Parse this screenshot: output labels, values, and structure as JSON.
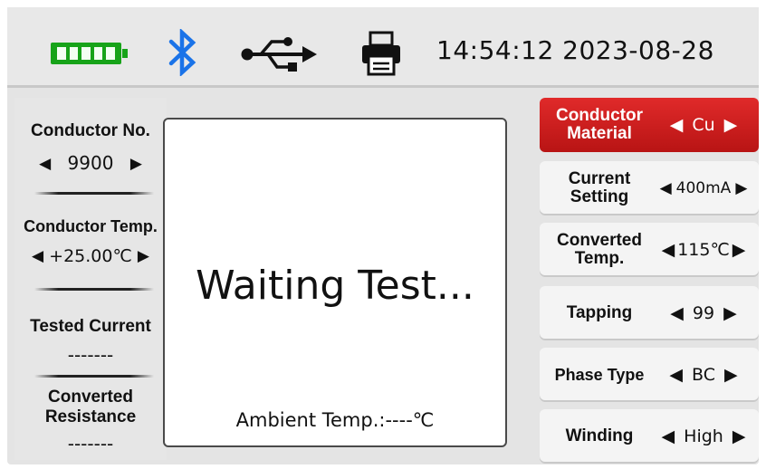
{
  "status": {
    "time": "14:54:12",
    "date": "2023-08-28",
    "battery_level": 1.0,
    "icons": [
      "battery-icon",
      "bluetooth-icon",
      "usb-icon",
      "printer-icon"
    ],
    "colors": {
      "battery": "#17a319",
      "bluetooth": "#1a73e8"
    }
  },
  "left": {
    "conductor_no_label": "Conductor No.",
    "conductor_no_value": "9900",
    "conductor_temp_label": "Conductor Temp.",
    "conductor_temp_value": "+25.00℃",
    "tested_current_label": "Tested Current",
    "tested_current_value": "-------",
    "converted_resistance_label_1": "Converted",
    "converted_resistance_label_2": "Resistance",
    "converted_resistance_value": "-------"
  },
  "center": {
    "message": "Waiting Test...",
    "ambient": "Ambient Temp.:----℃"
  },
  "right": [
    {
      "label_1": "Conductor",
      "label_2": "Material",
      "value": "Cu",
      "active": true
    },
    {
      "label_1": "Current",
      "label_2": "Setting",
      "value": "400mA",
      "active": false
    },
    {
      "label_1": "Converted",
      "label_2": "Temp.",
      "value": "115℃",
      "active": false
    },
    {
      "label_1": "Tapping",
      "label_2": "",
      "value": "99",
      "active": false
    },
    {
      "label_1": "Phase Type",
      "label_2": "",
      "value": "BC",
      "active": false
    },
    {
      "label_1": "Winding",
      "label_2": "",
      "value": "High",
      "active": false
    }
  ],
  "arrows": {
    "left": "◀",
    "right": "▶"
  },
  "accent_color": "#c81d1d"
}
